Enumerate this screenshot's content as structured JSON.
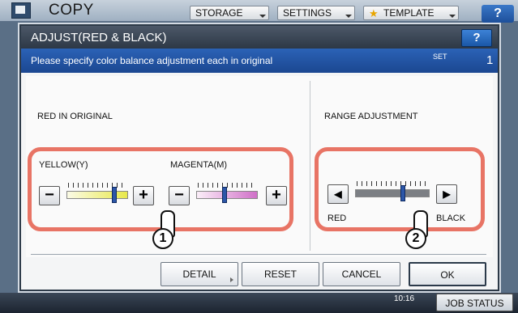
{
  "app": {
    "title": "COPY"
  },
  "top_buttons": {
    "storage": "STORAGE",
    "settings": "SETTINGS",
    "template": "TEMPLATE",
    "help": "?"
  },
  "dialog": {
    "title": "ADJUST(RED & BLACK)",
    "help": "?",
    "message": "Please specify color balance adjustment each in original",
    "set_label": "SET",
    "set_value": "1"
  },
  "red_in_original": {
    "heading": "RED IN ORIGINAL",
    "yellow": {
      "label": "YELLOW(Y)",
      "minus": "−",
      "plus": "+",
      "level_fraction": 0.8,
      "color": "#e8e84a"
    },
    "magenta": {
      "label": "MAGENTA(M)",
      "minus": "−",
      "plus": "+",
      "level_fraction": 0.45,
      "color": "#d070c8"
    }
  },
  "range_adjustment": {
    "heading": "RANGE ADJUSTMENT",
    "left_arrow": "◀",
    "right_arrow": "▶",
    "left_label": "RED",
    "right_label": "BLACK",
    "level_fraction": 0.65
  },
  "callouts": {
    "first": "1",
    "second": "2"
  },
  "footer": {
    "detail": "DETAIL",
    "reset": "RESET",
    "cancel": "CANCEL",
    "ok": "OK"
  },
  "status": {
    "time": "10:16",
    "job_status": "JOB STATUS"
  },
  "colors": {
    "highlight": "#e87465",
    "accent_blue": "#1b4791",
    "thumb": "#2c56a8"
  }
}
